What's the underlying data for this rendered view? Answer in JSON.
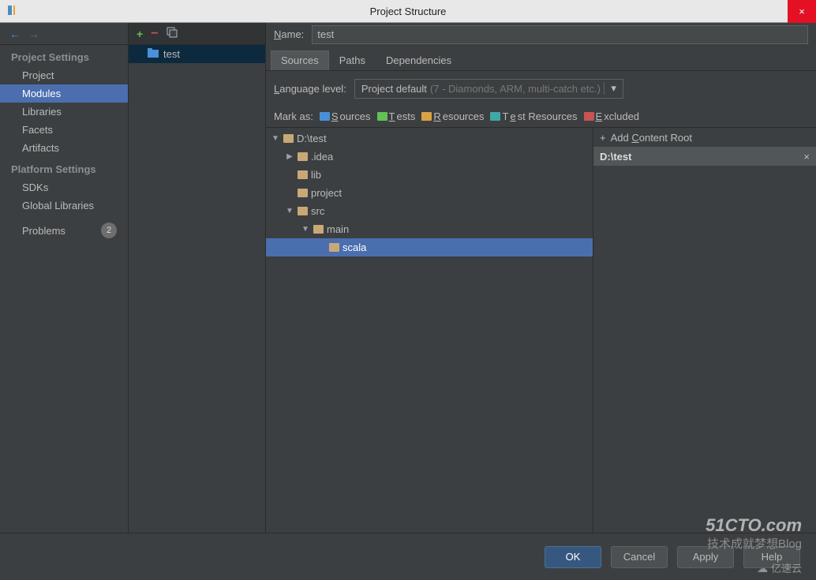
{
  "titlebar": {
    "title": "Project Structure",
    "close": "×"
  },
  "nav": {
    "back": "←",
    "forward": "→",
    "project_settings_hdr": "Project Settings",
    "items1": {
      "project": "Project",
      "modules": "Modules",
      "libraries": "Libraries",
      "facets": "Facets",
      "artifacts": "Artifacts"
    },
    "platform_settings_hdr": "Platform Settings",
    "items2": {
      "sdks": "SDKs",
      "global_libs": "Global Libraries"
    },
    "problems": "Problems",
    "problems_count": "2"
  },
  "mid": {
    "module_name": "test"
  },
  "form": {
    "name_label": "Name:",
    "name_value": "test",
    "tabs": {
      "sources": "Sources",
      "paths": "Paths",
      "dependencies": "Dependencies"
    },
    "lang_label": "Language level:",
    "lang_value": "Project default",
    "lang_suffix": "(7 - Diamonds, ARM, multi-catch etc.)",
    "mark_label": "Mark as:",
    "marks": {
      "sources": "Sources",
      "tests": "Tests",
      "resources": "Resources",
      "test_resources": "Test Resources",
      "excluded": "Excluded"
    }
  },
  "tree": {
    "root": "D:\\test",
    "idea": ".idea",
    "lib": "lib",
    "project": "project",
    "src": "src",
    "main": "main",
    "scala": "scala"
  },
  "roots": {
    "add_label": "Add Content Root",
    "item": "D:\\test",
    "close": "×"
  },
  "footer": {
    "ok": "OK",
    "cancel": "Cancel",
    "apply": "Apply",
    "help": "Help"
  },
  "watermark": {
    "line1": "51CTO.com",
    "line2": "技术成就梦想Blog",
    "line3": "亿速云"
  }
}
